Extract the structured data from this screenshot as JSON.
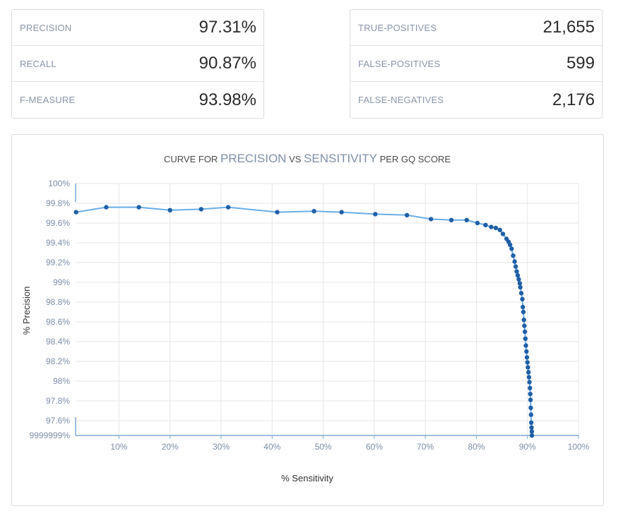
{
  "metrics_left": [
    {
      "label": "PRECISION",
      "value": "97.31%"
    },
    {
      "label": "RECALL",
      "value": "90.87%"
    },
    {
      "label": "F-MEASURE",
      "value": "93.98%"
    }
  ],
  "metrics_right": [
    {
      "label": "TRUE-POSITIVES",
      "value": "21,655"
    },
    {
      "label": "FALSE-POSITIVES",
      "value": "599"
    },
    {
      "label": "FALSE-NEGATIVES",
      "value": "2,176"
    }
  ],
  "chart_data": {
    "type": "line",
    "title_parts": [
      {
        "text": "CURVE FOR ",
        "emphasis": false
      },
      {
        "text": "PRECISION",
        "emphasis": true
      },
      {
        "text": " VS ",
        "emphasis": false
      },
      {
        "text": "SENSITIVITY",
        "emphasis": true
      },
      {
        "text": " PER GQ SCORE",
        "emphasis": false
      }
    ],
    "xlabel": "% Sensitivity",
    "ylabel": "% Precision",
    "xlim": [
      1.5,
      100
    ],
    "ylim": [
      97.45,
      100
    ],
    "x_ticks": [
      {
        "value": 10,
        "label": "10%"
      },
      {
        "value": 20,
        "label": "20%"
      },
      {
        "value": 30,
        "label": "30%"
      },
      {
        "value": 40,
        "label": "40%"
      },
      {
        "value": 50,
        "label": "50%"
      },
      {
        "value": 60,
        "label": "60%"
      },
      {
        "value": 70,
        "label": "70%"
      },
      {
        "value": 80,
        "label": "80%"
      },
      {
        "value": 90,
        "label": "90%"
      },
      {
        "value": 100,
        "label": "100%"
      }
    ],
    "y_ticks": [
      {
        "value": 100,
        "label": "100%"
      },
      {
        "value": 99.8,
        "label": "99.8%"
      },
      {
        "value": 99.6,
        "label": "99.6%"
      },
      {
        "value": 99.4,
        "label": "99.4%"
      },
      {
        "value": 99.2,
        "label": "99.2%"
      },
      {
        "value": 99,
        "label": "99%"
      },
      {
        "value": 98.8,
        "label": "98.8%"
      },
      {
        "value": 98.6,
        "label": "98.6%"
      },
      {
        "value": 98.4,
        "label": "98.4%"
      },
      {
        "value": 98.2,
        "label": "98.2%"
      },
      {
        "value": 98,
        "label": "98%"
      },
      {
        "value": 97.8,
        "label": "97.8%"
      },
      {
        "value": 97.6,
        "label": "97.6%"
      },
      {
        "value": 97.45,
        "label": "9999999%"
      }
    ],
    "grid": true,
    "line_color": "#6aaee6",
    "marker_color": "#1f5fa6",
    "x": [
      1.6,
      7.5,
      13.9,
      20.0,
      26.1,
      31.4,
      41.0,
      48.2,
      53.6,
      60.2,
      66.4,
      71.1,
      75.1,
      78.1,
      80.2,
      81.8,
      82.9,
      83.8,
      84.6,
      85.2,
      85.9,
      86.3,
      86.6,
      86.9,
      87.2,
      87.5,
      87.7,
      87.9,
      88.1,
      88.3,
      88.5,
      88.6,
      88.8,
      89.0,
      89.1,
      89.2,
      89.3,
      89.4,
      89.5,
      89.6,
      89.7,
      89.8,
      89.9,
      90.0,
      90.1,
      90.2,
      90.3,
      90.4,
      90.5,
      90.55,
      90.6,
      90.65,
      90.7,
      90.75,
      90.8,
      90.85,
      90.87
    ],
    "y": [
      99.71,
      99.76,
      99.76,
      99.73,
      99.74,
      99.76,
      99.71,
      99.72,
      99.71,
      99.69,
      99.68,
      99.64,
      99.63,
      99.63,
      99.6,
      99.58,
      99.56,
      99.55,
      99.53,
      99.49,
      99.44,
      99.41,
      99.38,
      99.34,
      99.27,
      99.21,
      99.16,
      99.11,
      99.07,
      99.03,
      98.99,
      98.95,
      98.89,
      98.83,
      98.75,
      98.7,
      98.62,
      98.56,
      98.5,
      98.43,
      98.36,
      98.3,
      98.24,
      98.19,
      98.14,
      98.09,
      98.04,
      97.99,
      97.93,
      97.87,
      97.81,
      97.73,
      97.66,
      97.58,
      97.53,
      97.49,
      97.45
    ]
  }
}
